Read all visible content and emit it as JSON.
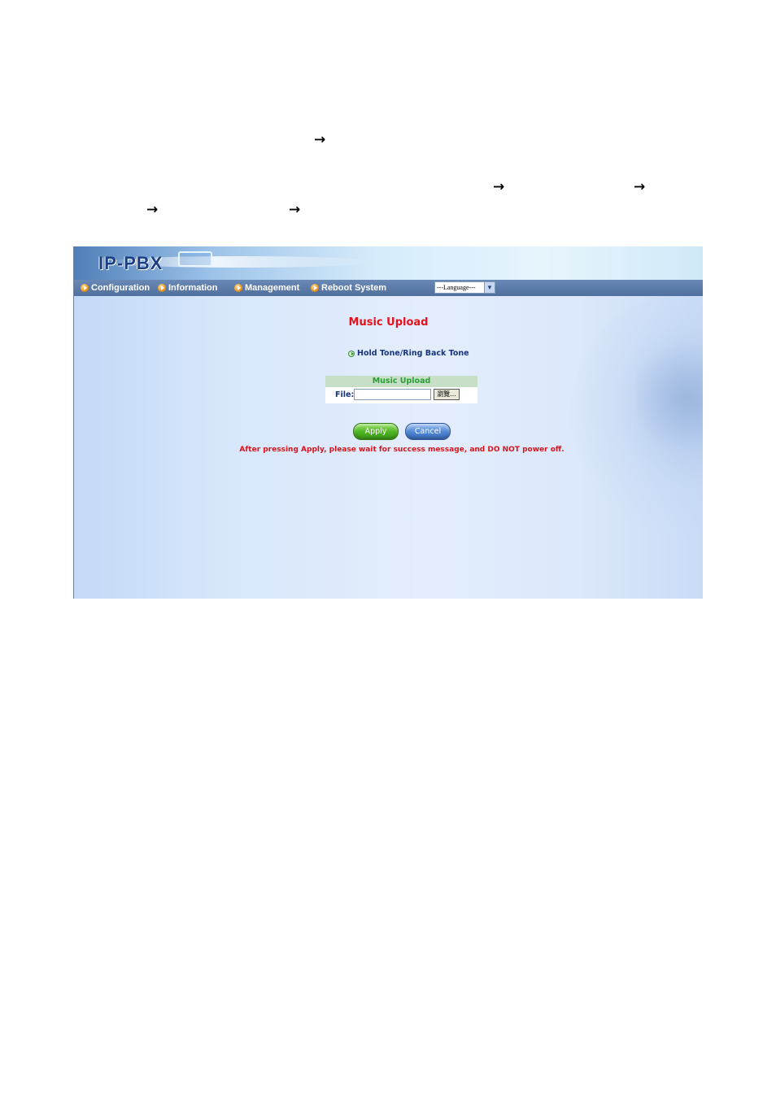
{
  "document": {
    "arrow_glyph": "→"
  },
  "app": {
    "logo": "IP-PBX",
    "menu": [
      {
        "label": "Configuration"
      },
      {
        "label": "Information"
      },
      {
        "label": "Management"
      },
      {
        "label": "Reboot System"
      }
    ],
    "language_select": {
      "value": "---Language---"
    }
  },
  "page": {
    "title": "Music Upload",
    "subnav_link": "Hold Tone/Ring Back Tone",
    "upload": {
      "header": "Music Upload",
      "file_label": "File:",
      "file_value": "",
      "browse_label": "瀏覽..."
    },
    "apply_label": "Apply",
    "cancel_label": "Cancel",
    "warning": "After pressing Apply, please wait for success message, and DO NOT power off."
  },
  "colors": {
    "title_red": "#e8101a",
    "menu_bar": "#4f6f9e",
    "apply_green": "#4cb420",
    "cancel_blue": "#4f86d4",
    "table_header": "#c6dfc6"
  }
}
